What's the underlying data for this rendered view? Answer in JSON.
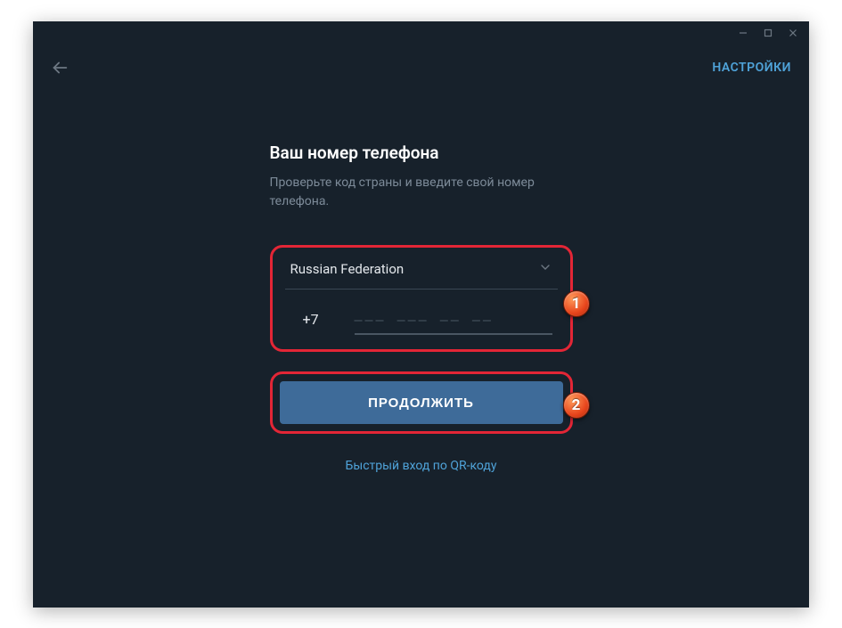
{
  "topbar": {
    "settings_label": "НАСТРОЙКИ"
  },
  "login": {
    "title": "Ваш номер телефона",
    "subtitle": "Проверьте код страны и введите свой номер телефона.",
    "country": "Russian Federation",
    "code": "+7",
    "phone_placeholder": "––– ––– –– ––",
    "continue_label": "ПРОДОЛЖИТЬ",
    "qr_label": "Быстрый вход по QR-коду"
  },
  "badges": {
    "one": "1",
    "two": "2"
  }
}
